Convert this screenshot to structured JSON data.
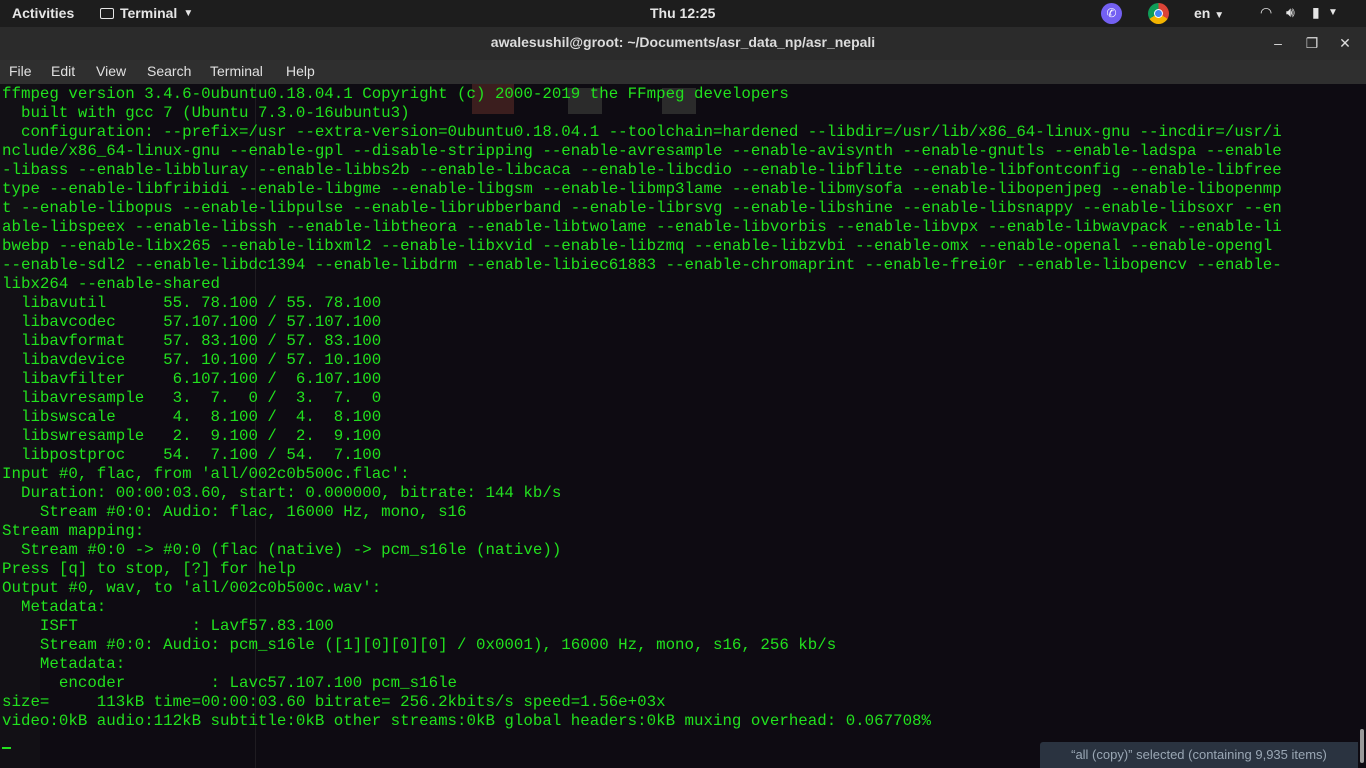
{
  "topbar": {
    "activities": "Activities",
    "app_name": "Terminal",
    "clock": "Thu 12:25",
    "lang": "en",
    "icons": [
      "viber-icon",
      "chrome-icon",
      "wifi-icon",
      "volume-icon",
      "battery-icon"
    ]
  },
  "window": {
    "title": "awalesushil@groot: ~/Documents/asr_data_np/asr_nepali"
  },
  "menu": {
    "items": [
      "File",
      "Edit",
      "View",
      "Search",
      "Terminal",
      "Help"
    ]
  },
  "terminal": {
    "fg_color": "#22e11e",
    "lines": [
      "ffmpeg version 3.4.6-0ubuntu0.18.04.1 Copyright (c) 2000-2019 the FFmpeg developers",
      "  built with gcc 7 (Ubuntu 7.3.0-16ubuntu3)",
      "  configuration: --prefix=/usr --extra-version=0ubuntu0.18.04.1 --toolchain=hardened --libdir=/usr/lib/x86_64-linux-gnu --incdir=/usr/i",
      "nclude/x86_64-linux-gnu --enable-gpl --disable-stripping --enable-avresample --enable-avisynth --enable-gnutls --enable-ladspa --enable",
      "-libass --enable-libbluray --enable-libbs2b --enable-libcaca --enable-libcdio --enable-libflite --enable-libfontconfig --enable-libfree",
      "type --enable-libfribidi --enable-libgme --enable-libgsm --enable-libmp3lame --enable-libmysofa --enable-libopenjpeg --enable-libopenmp",
      "t --enable-libopus --enable-libpulse --enable-librubberband --enable-librsvg --enable-libshine --enable-libsnappy --enable-libsoxr --en",
      "able-libspeex --enable-libssh --enable-libtheora --enable-libtwolame --enable-libvorbis --enable-libvpx --enable-libwavpack --enable-li",
      "bwebp --enable-libx265 --enable-libxml2 --enable-libxvid --enable-libzmq --enable-libzvbi --enable-omx --enable-openal --enable-opengl",
      "--enable-sdl2 --enable-libdc1394 --enable-libdrm --enable-libiec61883 --enable-chromaprint --enable-frei0r --enable-libopencv --enable-",
      "libx264 --enable-shared",
      "  libavutil      55. 78.100 / 55. 78.100",
      "  libavcodec     57.107.100 / 57.107.100",
      "  libavformat    57. 83.100 / 57. 83.100",
      "  libavdevice    57. 10.100 / 57. 10.100",
      "  libavfilter     6.107.100 /  6.107.100",
      "  libavresample   3.  7.  0 /  3.  7.  0",
      "  libswscale      4.  8.100 /  4.  8.100",
      "  libswresample   2.  9.100 /  2.  9.100",
      "  libpostproc    54.  7.100 / 54.  7.100",
      "Input #0, flac, from 'all/002c0b500c.flac':",
      "  Duration: 00:00:03.60, start: 0.000000, bitrate: 144 kb/s",
      "    Stream #0:0: Audio: flac, 16000 Hz, mono, s16",
      "Stream mapping:",
      "  Stream #0:0 -> #0:0 (flac (native) -> pcm_s16le (native))",
      "Press [q] to stop, [?] for help",
      "Output #0, wav, to 'all/002c0b500c.wav':",
      "  Metadata:",
      "    ISFT            : Lavf57.83.100",
      "    Stream #0:0: Audio: pcm_s16le ([1][0][0][0] / 0x0001), 16000 Hz, mono, s16, 256 kb/s",
      "    Metadata:",
      "      encoder         : Lavc57.107.100 pcm_s16le",
      "size=     113kB time=00:00:03.60 bitrate= 256.2kbits/s speed=1.56e+03x",
      "video:0kB audio:112kB subtitle:0kB other streams:0kB global headers:0kB muxing overhead: 0.067708%",
      ""
    ]
  },
  "status_overlay": {
    "text": "“all (copy)” selected  (containing 9,935 items)"
  }
}
